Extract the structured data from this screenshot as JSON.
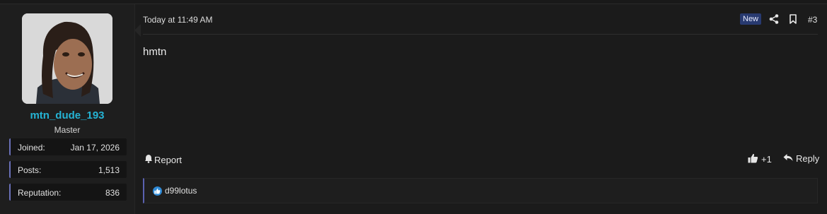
{
  "user": {
    "username": "mtn_dude_193",
    "title": "Master",
    "stats": [
      {
        "label": "Joined:",
        "value": "Jan 17, 2026"
      },
      {
        "label": "Posts:",
        "value": "1,513"
      },
      {
        "label": "Reputation:",
        "value": "836"
      }
    ]
  },
  "post": {
    "timestamp": "Today at 11:49 AM",
    "new_badge": "New",
    "number": "#3",
    "message": "hmtn"
  },
  "actions": {
    "report": "Report",
    "like_count": "+1",
    "reply": "Reply"
  },
  "reactions": {
    "users": "d99lotus"
  },
  "icons": {
    "share": "share-icon",
    "bookmark": "bookmark-icon",
    "report": "bell-icon",
    "like": "thumbs-up-icon",
    "reply": "reply-arrow-icon"
  },
  "colors": {
    "username": "#25b3d4",
    "new_badge_bg": "#283a70",
    "stat_accent": "#6a70b8",
    "reaction_like": "#2f8ad6"
  }
}
